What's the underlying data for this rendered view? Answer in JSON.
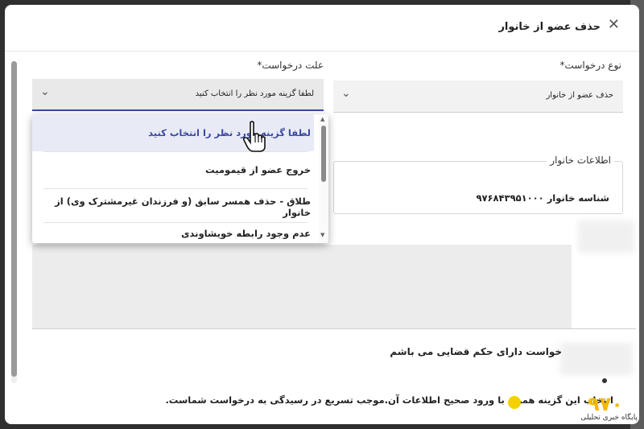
{
  "dialog": {
    "title": "حذف عضو از خانوار",
    "close_icon": "close-icon"
  },
  "form": {
    "request_type_label": "نوع درخواست*",
    "request_type_value": "حذف عضو از خانوار",
    "reason_label": "علت درخواست*",
    "reason_placeholder": "لطفا گزینه مورد نظر را انتخاب کنید",
    "reason_options": [
      "لطفا گزینه مورد نظر را انتخاب کنید",
      "خروج عضو از قیمومیت",
      "طلاق - حذف همسر سابق (و فرزندان غیرمشترک وی) از خانوار",
      "عدم وجود رابطه خویشاوندی"
    ],
    "family_info_legend": "اطلاعات خانوار",
    "family_id": "شناسه خانوار ۹۷۶۸۴۳۹۵۱۰۰۰",
    "court_order_text": "خواست دارای حکم قضایی می باشم",
    "note_text": "انتخاب این گزینه همراه با ورود صحیح اطلاعات آن.موجب تسریع در رسیدگی به درخواست شماست."
  },
  "watermark": {
    "logo_text": "٩٧٠",
    "caption": "پایگاه خبری تحلیلی"
  },
  "colors": {
    "accent": "#3a4aa0",
    "logo": "#f5b800"
  }
}
